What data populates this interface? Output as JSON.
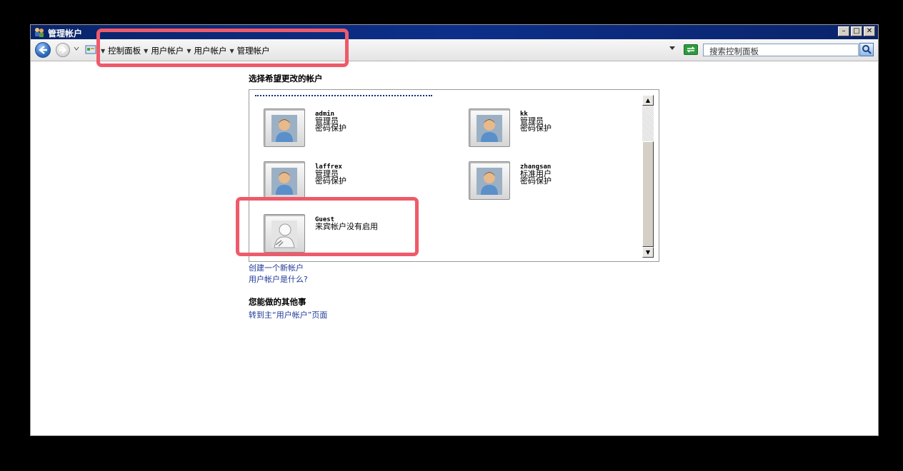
{
  "window": {
    "title": "管理帐户"
  },
  "navbar": {
    "breadcrumb": [
      "控制面板",
      "用户帐户",
      "用户帐户",
      "管理帐户"
    ],
    "search_placeholder": "搜索控制面板"
  },
  "main": {
    "heading": "选择希望更改的帐户",
    "accounts": [
      {
        "name": "admin",
        "line1": "管理员",
        "line2": "密码保护"
      },
      {
        "name": "kk",
        "line1": "管理员",
        "line2": "密码保护"
      },
      {
        "name": "laffrex",
        "line1": "管理员",
        "line2": "密码保护"
      },
      {
        "name": "zhangsan",
        "line1": "标准用户",
        "line2": "密码保护"
      },
      {
        "name": "Guest",
        "line1": "来宾帐户没有启用"
      }
    ],
    "links": [
      "创建一个新帐户",
      "用户帐户是什么?"
    ],
    "other_title": "您能做的其他事",
    "other_links": [
      "转到主“用户帐户”页面"
    ]
  },
  "highlight_color": "#ef5a6a"
}
